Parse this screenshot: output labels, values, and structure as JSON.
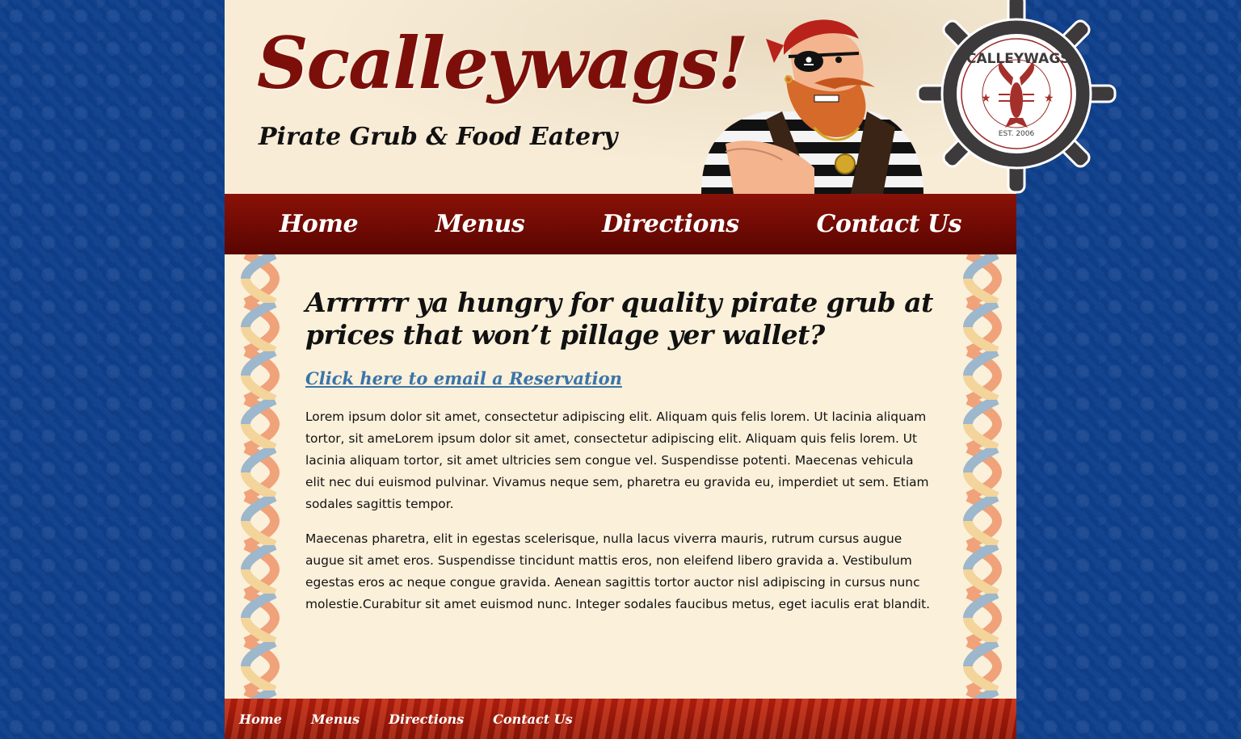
{
  "header": {
    "title": "Scalleywags!",
    "tagline": "Pirate Grub & Food Eatery",
    "logo": {
      "ring_text": "SCALLEYWAGS!",
      "established": "EST. 2006"
    }
  },
  "nav": {
    "items": [
      {
        "label": "Home"
      },
      {
        "label": "Menus"
      },
      {
        "label": "Directions"
      },
      {
        "label": "Contact Us"
      }
    ]
  },
  "main": {
    "heading": "Arrrrrr ya hungry for quality pirate grub at prices that won’t pillage yer wallet?",
    "reservation_link": "Click here to email a Reservation",
    "paragraphs": [
      "Lorem ipsum dolor sit amet, consectetur adipiscing elit. Aliquam quis felis lorem. Ut lacinia aliquam tortor, sit ameLorem ipsum dolor sit amet, consectetur adipiscing elit. Aliquam quis felis lorem. Ut lacinia aliquam tortor, sit amet ultricies sem congue vel. Suspendisse potenti. Maecenas vehicula elit nec dui euismod pulvinar. Vivamus neque sem, pharetra eu gravida eu, imperdiet ut sem. Etiam sodales sagittis tempor.",
      "Maecenas pharetra, elit in egestas scelerisque, nulla lacus viverra mauris, rutrum cursus augue augue sit amet eros. Suspendisse tincidunt mattis eros, non eleifend libero gravida a. Vestibulum egestas eros ac neque congue gravida. Aenean sagittis tortor auctor nisl adipiscing in cursus nunc molestie.Curabitur sit amet euismod nunc. Integer sodales faucibus metus, eget iaculis erat blandit."
    ]
  },
  "footer": {
    "links": [
      {
        "label": "Home"
      },
      {
        "label": "Menus"
      },
      {
        "label": "Directions"
      },
      {
        "label": "Contact Us"
      }
    ]
  },
  "colors": {
    "background_blue": "#0f3f8c",
    "title_red": "#7c0f0a",
    "nav_red": "#6e0a04",
    "link_blue": "#3a74a8",
    "cream": "#fbeed8"
  }
}
